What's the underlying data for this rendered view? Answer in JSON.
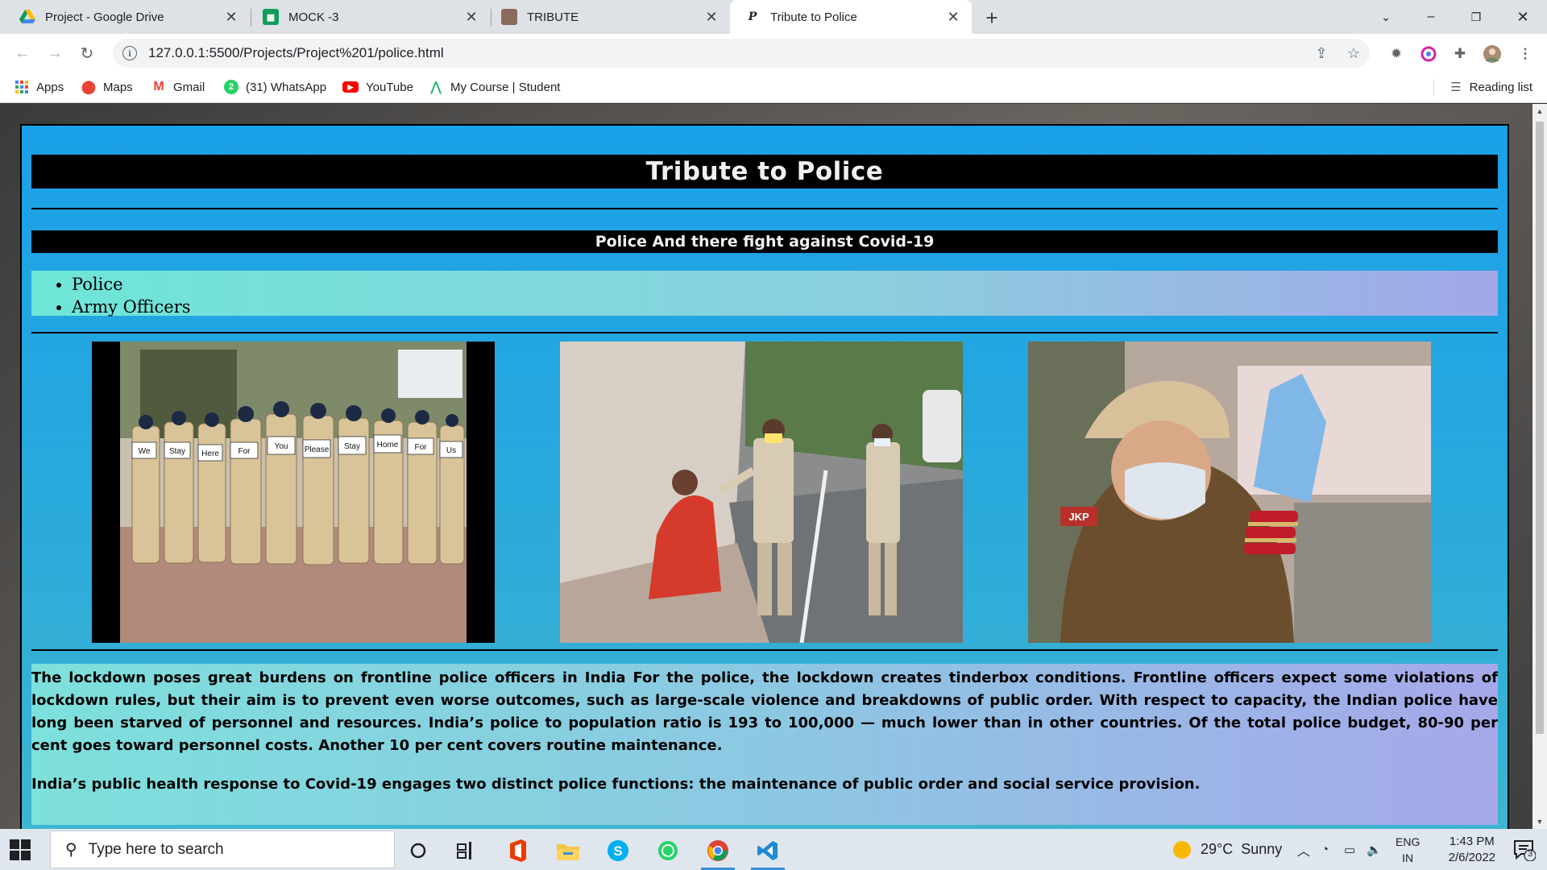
{
  "browser": {
    "tabs": [
      {
        "title": "Project - Google Drive",
        "active": false
      },
      {
        "title": "MOCK -3",
        "active": false
      },
      {
        "title": "TRIBUTE",
        "active": false
      },
      {
        "title": "Tribute to Police",
        "active": true
      }
    ],
    "url": "127.0.0.1:5500/Projects/Project%201/police.html",
    "bookmarks": [
      "Apps",
      "Maps",
      "Gmail",
      "(31) WhatsApp",
      "YouTube",
      "My Course | Student"
    ],
    "reading_list": "Reading list"
  },
  "page": {
    "title": "Tribute to Police",
    "subtitle": "Police And there fight against Covid-19",
    "list_items": [
      "Police",
      "Army Officers"
    ],
    "photo_signs": [
      "We",
      "Stay",
      "Here",
      "For",
      "You",
      "Please",
      "Stay",
      "Home",
      "For",
      "Us"
    ],
    "photo_badge": "JKP",
    "paragraphs": [
      "The lockdown poses great burdens on frontline police officers in India For the police, the lockdown creates tinderbox conditions. Frontline officers expect some violations of lockdown rules, but their aim is to prevent even worse outcomes, such as large-scale violence and breakdowns of public order. With respect to capacity, the Indian police have long been starved of personnel and resources. India’s police to population ratio is 193 to 100,000 — much lower than in other countries. Of the total police budget, 80-90 per cent goes toward personnel costs. Another 10 per cent covers routine maintenance.",
      "India’s public health response to Covid-19 engages two distinct police functions: the maintenance of public order and social service provision."
    ]
  },
  "taskbar": {
    "search_placeholder": "Type here to search",
    "weather": "29°C  Sunny",
    "lang_line1": "ENG",
    "lang_line2": "IN",
    "time": "1:43 PM",
    "date": "2/6/2022",
    "notification_count": "3"
  }
}
